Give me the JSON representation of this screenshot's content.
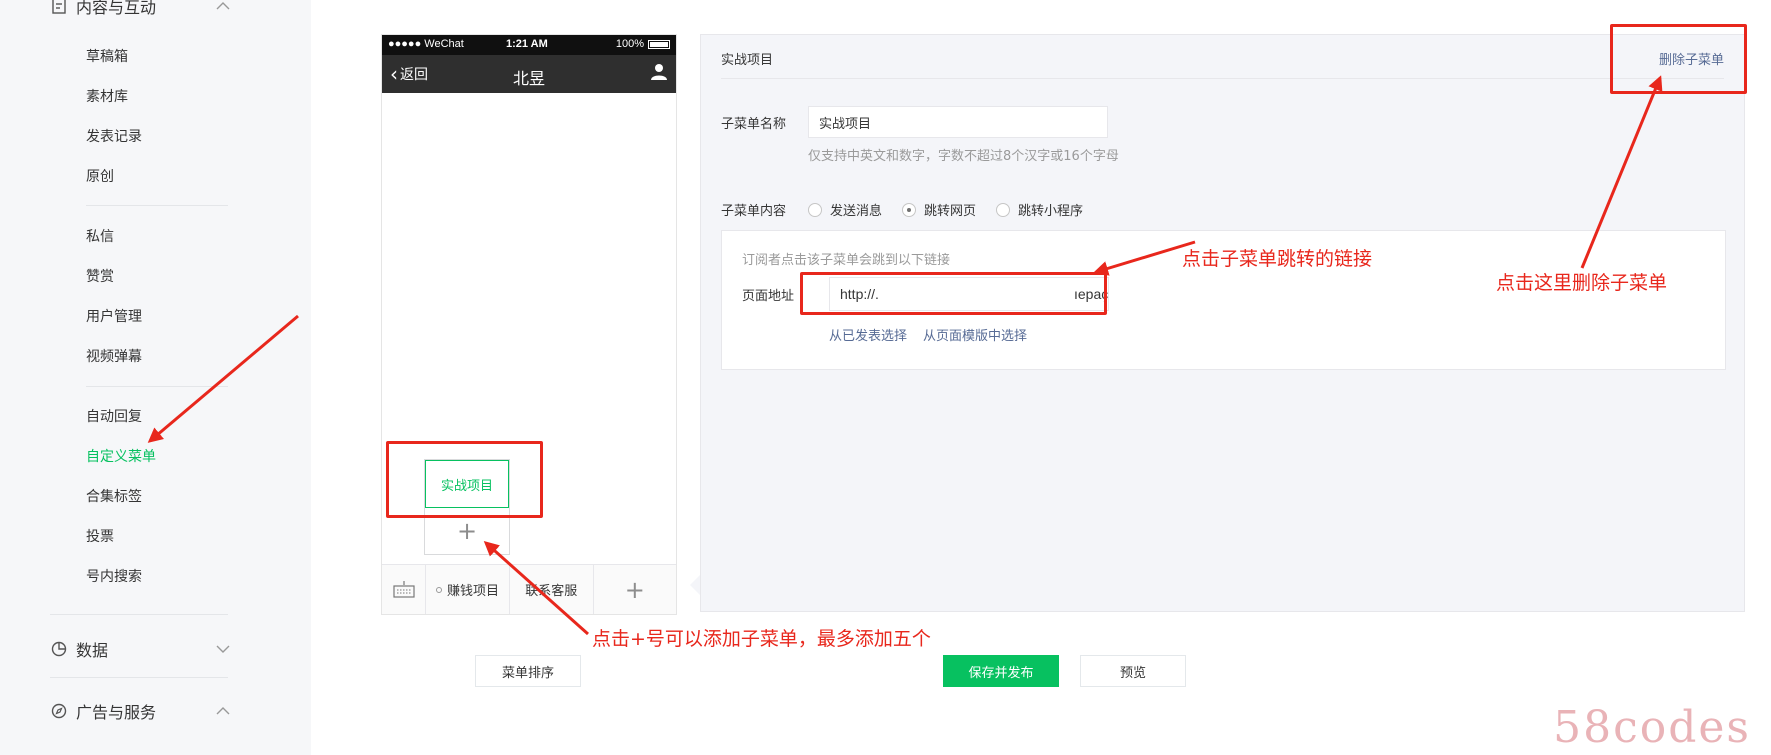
{
  "sidebar": {
    "group_content": "内容与互动",
    "group1_items": [
      "草稿箱",
      "素材库",
      "发表记录",
      "原创"
    ],
    "group2_items": [
      "私信",
      "赞赏",
      "用户管理",
      "视频弹幕"
    ],
    "group3_items": [
      "自动回复",
      "自定义菜单",
      "合集标签",
      "投票",
      "号内搜索"
    ],
    "active_item": "自定义菜单",
    "group_data": "数据",
    "group_ads": "广告与服务"
  },
  "phone": {
    "carrier": "●●●●● WeChat",
    "time": "1:21 AM",
    "battery": "100%",
    "back_label": "返回",
    "title": "北昱",
    "sub_menu_item": "实战项目",
    "sub_menu_add": "+",
    "menu_items": [
      "赚钱项目",
      "联系客服"
    ],
    "menu_add": "+"
  },
  "editor": {
    "title": "实战项目",
    "delete_label": "删除子菜单",
    "name_label": "子菜单名称",
    "name_value": "实战项目",
    "name_hint": "仅支持中英文和数字，字数不超过8个汉字或16个字母",
    "content_label": "子菜单内容",
    "options": [
      "发送消息",
      "跳转网页",
      "跳转小程序"
    ],
    "selected_option": "跳转网页",
    "link_tip": "订阅者点击该子菜单会跳到以下链接",
    "url_label": "页面地址",
    "url_value": "http://.",
    "url_tail": "ıepaç",
    "link_from_published": "从已发表选择",
    "link_from_template": "从页面模版中选择"
  },
  "buttons": {
    "sort": "菜单排序",
    "save_publish": "保存并发布",
    "preview": "预览"
  },
  "annotations": {
    "link_note": "点击子菜单跳转的链接",
    "delete_note": "点击这里删除子菜单",
    "add_note": "点击+号可以添加子菜单，最多添加五个"
  },
  "watermark": "58codes",
  "colors": {
    "brand_green": "#07c160",
    "link_blue": "#576b95",
    "annotation_red": "#e8271c"
  }
}
